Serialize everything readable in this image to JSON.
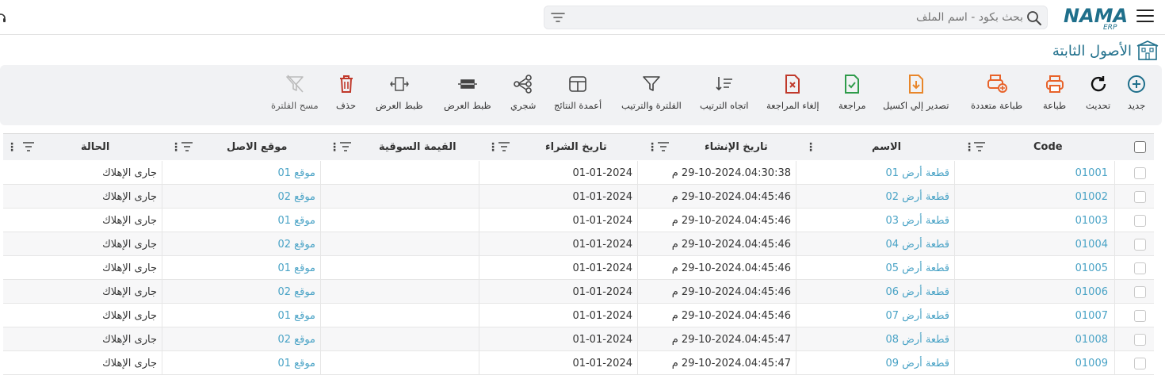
{
  "app": {
    "brand": "NAMA",
    "brand_sub": "ERP"
  },
  "search": {
    "placeholder": "بحث بكود - اسم الملف"
  },
  "page": {
    "title": "الأصول الثابتة"
  },
  "toolbar": {
    "new": "جديد",
    "refresh": "تحديث",
    "print": "طباعة",
    "multi_print": "طباعة متعددة",
    "export_excel": "تصدير إلي اكسيل",
    "review": "مراجعة",
    "cancel_review": "إلغاء المراجعة",
    "sort_direction": "اتجاه الترتيب",
    "filter_sort": "الفلترة والترتيب",
    "result_columns": "أعمدة النتائج",
    "tree": "شجري",
    "fit_width_1": "ظبط العرض",
    "fit_width_2": "ظبط العرض",
    "delete": "حذف",
    "clear_filter": "مسح الفلترة"
  },
  "colors": {
    "accent": "#1f6f8b",
    "link": "#4aa3c6",
    "excel": "#e8862a",
    "print": "#e8632a",
    "review": "#2e9b4a",
    "cancel": "#c0392b"
  },
  "table": {
    "headers": {
      "code": "Code",
      "name": "الاسم",
      "created": "تاريخ الإنشاء",
      "purchase": "تاريخ الشراء",
      "market": "القيمة السوقية",
      "location": "موقع الاصل",
      "status": "الحالة"
    },
    "rows": [
      {
        "code": "01001",
        "name": "قطعة أرض 01",
        "created": "29-10-2024.04:30:38 م",
        "purchase": "01-01-2024",
        "market": "",
        "location": "موقع 01",
        "status": "جارى الإهلاك"
      },
      {
        "code": "01002",
        "name": "قطعة أرض 02",
        "created": "29-10-2024.04:45:46 م",
        "purchase": "01-01-2024",
        "market": "",
        "location": "موقع 02",
        "status": "جارى الإهلاك"
      },
      {
        "code": "01003",
        "name": "قطعة أرض 03",
        "created": "29-10-2024.04:45:46 م",
        "purchase": "01-01-2024",
        "market": "",
        "location": "موقع 01",
        "status": "جارى الإهلاك"
      },
      {
        "code": "01004",
        "name": "قطعة أرض 04",
        "created": "29-10-2024.04:45:46 م",
        "purchase": "01-01-2024",
        "market": "",
        "location": "موقع 02",
        "status": "جارى الإهلاك"
      },
      {
        "code": "01005",
        "name": "قطعة أرض 05",
        "created": "29-10-2024.04:45:46 م",
        "purchase": "01-01-2024",
        "market": "",
        "location": "موقع 01",
        "status": "جارى الإهلاك"
      },
      {
        "code": "01006",
        "name": "قطعة أرض 06",
        "created": "29-10-2024.04:45:46 م",
        "purchase": "01-01-2024",
        "market": "",
        "location": "موقع 02",
        "status": "جارى الإهلاك"
      },
      {
        "code": "01007",
        "name": "قطعة أرض 07",
        "created": "29-10-2024.04:45:46 م",
        "purchase": "01-01-2024",
        "market": "",
        "location": "موقع 01",
        "status": "جارى الإهلاك"
      },
      {
        "code": "01008",
        "name": "قطعة أرض 08",
        "created": "29-10-2024.04:45:47 م",
        "purchase": "01-01-2024",
        "market": "",
        "location": "موقع 02",
        "status": "جارى الإهلاك"
      },
      {
        "code": "01009",
        "name": "قطعة أرض 09",
        "created": "29-10-2024.04:45:47 م",
        "purchase": "01-01-2024",
        "market": "",
        "location": "موقع 01",
        "status": "جارى الإهلاك"
      }
    ]
  }
}
